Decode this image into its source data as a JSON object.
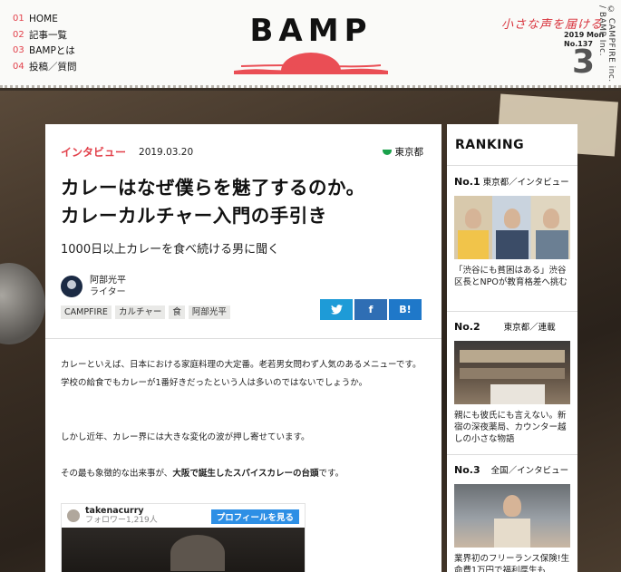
{
  "nav": {
    "items": [
      {
        "num": "01",
        "label": "HOME"
      },
      {
        "num": "02",
        "label": "記事一覧"
      },
      {
        "num": "03",
        "label": "BAMPとは"
      },
      {
        "num": "04",
        "label": "投稿／質問"
      }
    ]
  },
  "header": {
    "logo": "BAMP",
    "tagline": "小さな声を届ける",
    "issue_year": "2019 Mon",
    "issue_no": "No.137",
    "issue_month": "3",
    "copyright": "© CAMPFIRE inc. / BAMP Inc."
  },
  "colors": {
    "accent": "#e2414b",
    "twitter": "#1e9bd7",
    "facebook": "#2f6eb4",
    "hatena": "#1f78c9",
    "location": "#1aa14b"
  },
  "article": {
    "category": "インタビュー",
    "date": "2019.03.20",
    "location": "東京都",
    "title_line1": "カレーはなぜ僕らを魅了するのか。",
    "title_line2": "カレーカルチャー入門の手引き",
    "subtitle": "1000日以上カレーを食べ続ける男に聞く",
    "author_name": "阿部光平",
    "author_role": "ライター",
    "tags": [
      "CAMPFIRE",
      "カルチャー",
      "食",
      "阿部光平"
    ],
    "share": {
      "twitter": "twitter-icon",
      "facebook": "f",
      "hatena": "B!"
    },
    "p1": "カレーといえば、日本における家庭料理の大定番。老若男女問わず人気のあるメニューです。学校の給食でもカレーが1番好きだったという人は多いのではないでしょうか。",
    "p2": "しかし近年、カレー界には大きな変化の波が押し寄せています。",
    "p3_pre": "その最も象徴的な出来事が、",
    "p3_bold": "大阪で誕生したスパイスカレーの台頭",
    "p3_post": "です。",
    "embed": {
      "user": "takenacurry",
      "followers": "フォロワー1,219人",
      "button": "プロフィールを見る"
    }
  },
  "ranking": {
    "title": "RANKING",
    "items": [
      {
        "no": "No.1",
        "meta": "東京都／インタビュー",
        "text": "「渋谷にも貧困はある」渋谷区長とNPOが教育格差へ挑む"
      },
      {
        "no": "No.2",
        "meta": "東京都／連載",
        "text": "親にも彼氏にも言えない。新宿の深夜薬局、カウンター越しの小さな物語"
      },
      {
        "no": "No.3",
        "meta": "全国／インタビュー",
        "text": "業界初のフリーランス保険!生命費1万円で福利厚生も"
      }
    ]
  }
}
